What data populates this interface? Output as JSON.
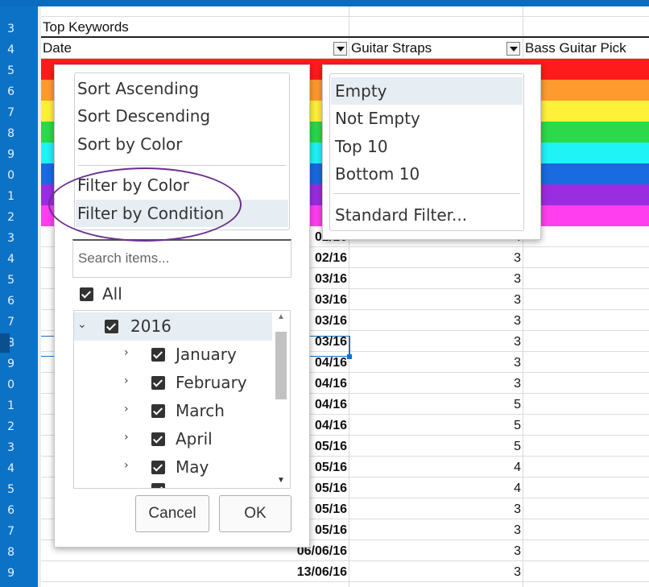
{
  "row_numbers": [
    "3",
    "4",
    "5",
    "6",
    "7",
    "8",
    "9",
    "0",
    "1",
    "2",
    "3",
    "4",
    "5",
    "6",
    "7",
    "8",
    "9",
    "0",
    "1",
    "2",
    "3",
    "4",
    "5",
    "6",
    "7",
    "8",
    "9"
  ],
  "sheet": {
    "title": "Top Keywords",
    "columns": [
      "Date",
      "Guitar Straps",
      "Bass Guitar Pick"
    ],
    "stripe_colors": [
      "#ff1b1b",
      "#ff9b2e",
      "#fff13a",
      "#2bd94a",
      "#1ff3f6",
      "#1a6ae0",
      "#9b2de0",
      "#ff3ef0"
    ],
    "rows": [
      {
        "date": "02/16",
        "value": "4"
      },
      {
        "date": "02/16",
        "value": "3"
      },
      {
        "date": "03/16",
        "value": "3"
      },
      {
        "date": "03/16",
        "value": "3"
      },
      {
        "date": "03/16",
        "value": "3"
      },
      {
        "date": "03/16",
        "value": "3"
      },
      {
        "date": "04/16",
        "value": "3"
      },
      {
        "date": "04/16",
        "value": "3"
      },
      {
        "date": "04/16",
        "value": "5"
      },
      {
        "date": "04/16",
        "value": "5"
      },
      {
        "date": "05/16",
        "value": "5"
      },
      {
        "date": "05/16",
        "value": "4"
      },
      {
        "date": "05/16",
        "value": "4"
      },
      {
        "date": "05/16",
        "value": "3"
      },
      {
        "date": "05/16",
        "value": "3"
      },
      {
        "date": "06/06/16",
        "value": "3"
      },
      {
        "date": "13/06/16",
        "value": "3"
      }
    ]
  },
  "autofilter": {
    "menu": [
      "Sort Ascending",
      "Sort Descending",
      "Sort by Color",
      "Filter by Color",
      "Filter by Condition"
    ],
    "search_placeholder": "Search items...",
    "all_label": "All",
    "tree": [
      "2016",
      "January",
      "February",
      "March",
      "April",
      "May"
    ],
    "cancel": "Cancel",
    "ok": "OK"
  },
  "condition_menu": [
    "Empty",
    "Not Empty",
    "Top 10",
    "Bottom 10",
    "Standard Filter..."
  ],
  "colors": {
    "highlight_oval": "#6b2f8e",
    "row_header": "#0b72c6",
    "accent": "#1f6fc0"
  }
}
